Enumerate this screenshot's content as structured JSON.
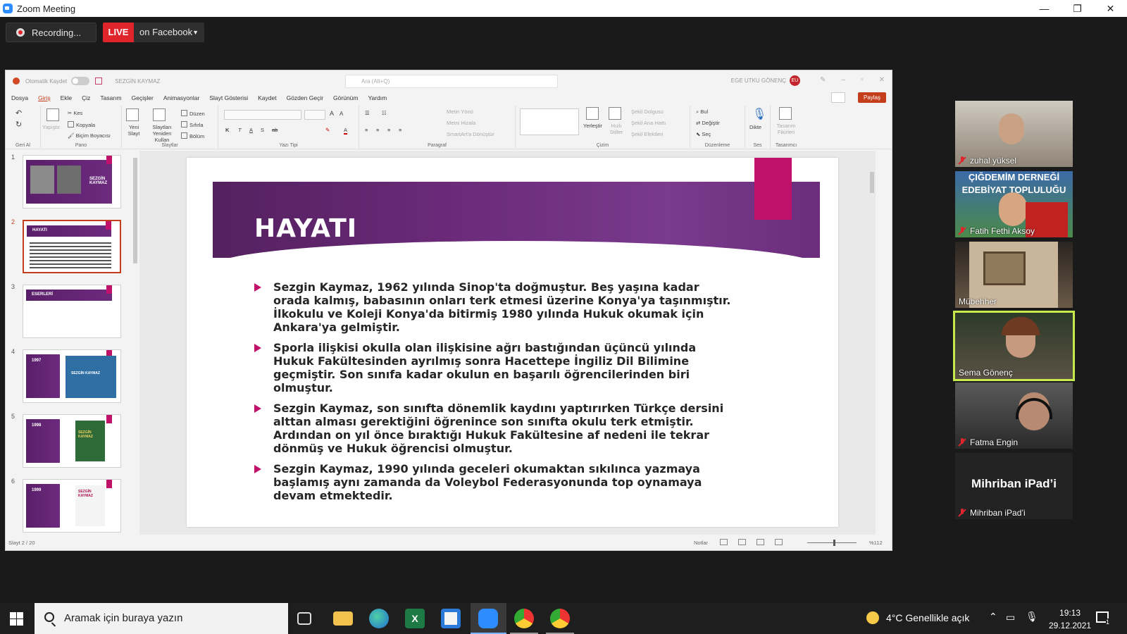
{
  "zoom": {
    "window_title": "Zoom Meeting",
    "win_min": "—",
    "win_max": "❐",
    "win_close": "✕",
    "recording_label": "Recording...",
    "live_badge": "LIVE",
    "live_target": "on Facebook",
    "caret": "▼"
  },
  "ppt": {
    "autosave_label": "Otomatik Kaydet",
    "file_name": "SEZGİN KAYMAZ",
    "search_placeholder": "Ara (Alt+Q)",
    "user_name": "EGE UTKU GÖNENÇ",
    "user_initials": "EU",
    "menu": [
      "Dosya",
      "Giriş",
      "Ekle",
      "Çiz",
      "Tasarım",
      "Geçişler",
      "Animasyonlar",
      "Slayt Gösterisi",
      "Kaydet",
      "Gözden Geçir",
      "Görünüm",
      "Yardım"
    ],
    "share_label": "Paylaş",
    "ribbon": {
      "groups": [
        "Geri Al",
        "Pano",
        "Slaytlar",
        "Yazı Tipi",
        "Paragraf",
        "Çizim",
        "Düzenleme",
        "Ses",
        "Tasarımcı"
      ],
      "paste": "Yapıştır",
      "cut": "Kes",
      "copy": "Kopyala",
      "format_painter": "Biçim Boyacısı",
      "new_slide": "Yeni Slayt",
      "reuse_slides": "Slaytları Yeniden Kullan",
      "layout": "Düzen",
      "reset": "Sıfırla",
      "section": "Bölüm",
      "text_direction": "Metin Yönü",
      "align_text": "Metni Hizala",
      "smartart": "SmartArt'a Dönüştür",
      "arrange": "Yerleştir",
      "quick_styles": "Hızlı Stiller",
      "shape_fill": "Şekil Dolgusu",
      "shape_outline": "Şekil Ana Hattı",
      "shape_effects": "Şekil Efektleri",
      "find": "Bul",
      "replace": "Değiştir",
      "select": "Seç",
      "dictate": "Dikte",
      "design_ideas": "Tasarım Fikirleri"
    },
    "thumbs": [
      {
        "num": "1",
        "label": "SEZGİN KAYMAZ"
      },
      {
        "num": "2",
        "label": "HAYATI"
      },
      {
        "num": "3",
        "label": "ESERLERİ"
      },
      {
        "num": "4",
        "label": "1997",
        "cover": "SEZGİN KAYMAZ"
      },
      {
        "num": "5",
        "label": "1998",
        "cover": "SEZGİN KAYMAZ"
      },
      {
        "num": "6",
        "label": "1999",
        "cover": "SEZGİN KAYMAZ"
      }
    ],
    "slide": {
      "title": "HAYATI",
      "bullets": [
        "Sezgin Kaymaz, 1962 yılında Sinop'ta doğmuştur. Beş yaşına kadar orada kalmış, babasının onları terk etmesi üzerine Konya'ya taşınmıştır. İlkokulu ve Koleji Konya'da bitirmiş 1980 yılında Hukuk okumak için Ankara'ya gelmiştir.",
        "Sporla ilişkisi okulla olan ilişkisine ağrı bastığından üçüncü yılında Hukuk Fakültesinden ayrılmış sonra Hacettepe İngiliz Dil Bilimine geçmiştir. Son sınıfa kadar okulun en başarılı öğrencilerinden biri olmuştur.",
        "Sezgin Kaymaz, son sınıfta dönemlik kaydını yaptırırken Türkçe dersini alttan alması gerektiğini öğrenince son sınıfta okulu terk etmiştir. Ardından on yıl önce bıraktığı Hukuk Fakültesine af nedeni ile tekrar dönmüş ve Hukuk öğrencisi olmuştur.",
        "Sezgin Kaymaz, 1990 yılında geceleri okumaktan sıkılınca yazmaya başlamış aynı zamanda da Voleybol Federasyonunda top oynamaya devam etmektedir."
      ]
    },
    "status": {
      "slide_counter": "Slayt 2 / 20",
      "notes": "Notlar",
      "zoom": "%112"
    }
  },
  "participants": [
    {
      "name": "zuhal yüksel",
      "muted": true
    },
    {
      "name": "Fatih Fethi Aksoy",
      "muted": true,
      "overlay_line1": "ÇIĞDEMİM DERNEĞİ",
      "overlay_line2": "EDEBİYAT TOPLULUĞU"
    },
    {
      "name": "Mübehher",
      "muted": false
    },
    {
      "name": "Sema Gönenç",
      "muted": false,
      "speaking": true
    },
    {
      "name": "Fatma Engin",
      "muted": true
    },
    {
      "name": "Mihriban iPad’i",
      "muted": true,
      "avatar_text": "Mihriban iPad’i"
    }
  ],
  "taskbar": {
    "search_placeholder": "Aramak için buraya yazın",
    "weather": "4°C  Genellikle açık",
    "time": "19:13",
    "date": "29.12.2021",
    "notification_count": "1"
  }
}
